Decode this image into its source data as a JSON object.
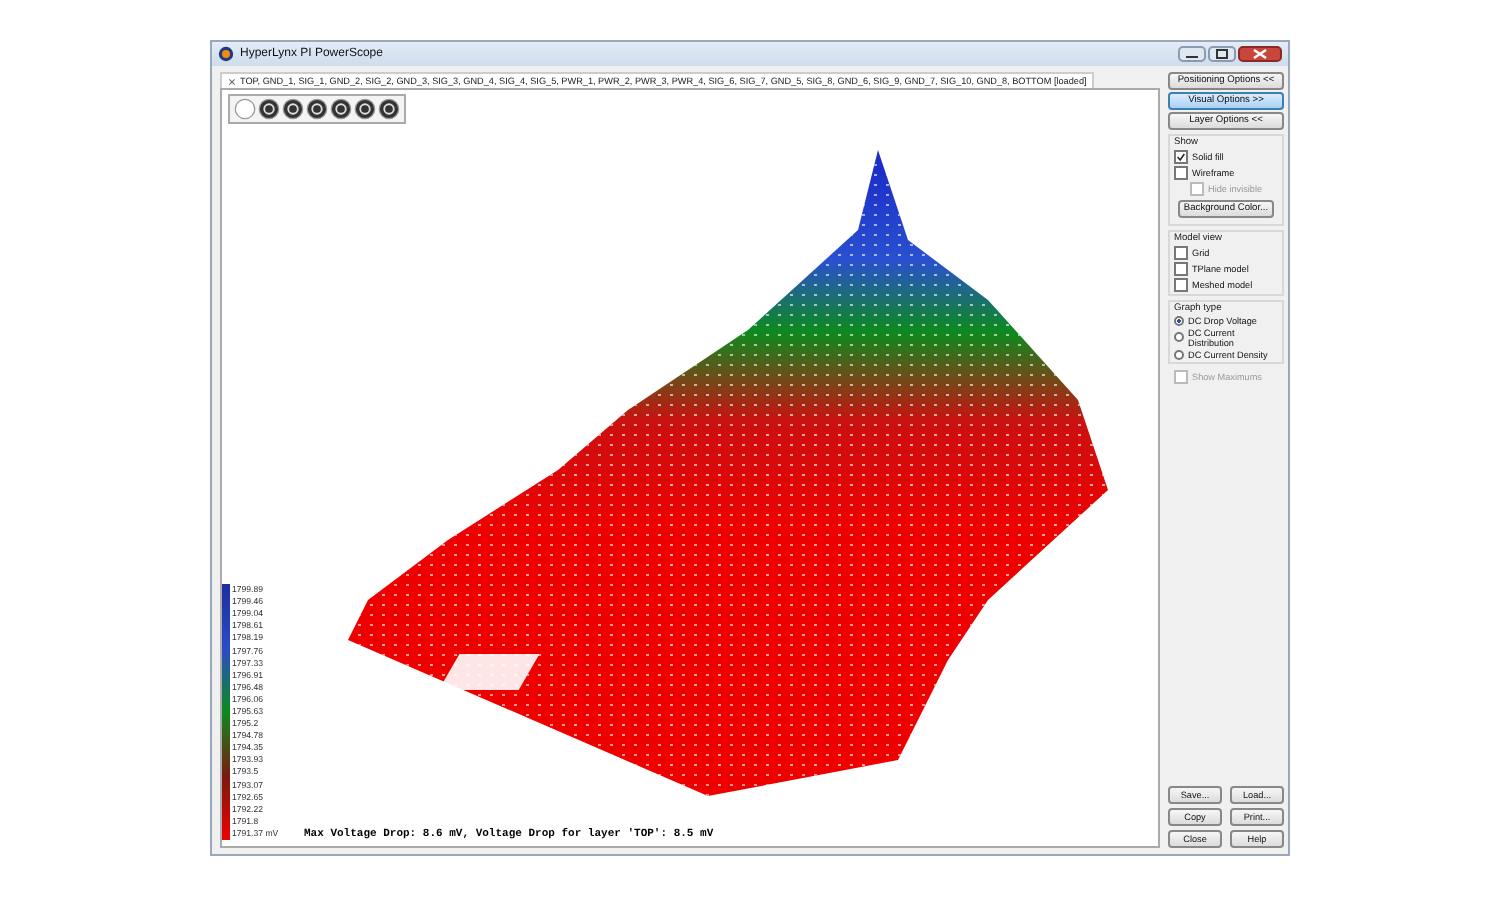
{
  "window": {
    "title": "HyperLynx PI PowerScope"
  },
  "tab": {
    "label": "TOP, GND_1, SIG_1, GND_2, SIG_2, GND_3, SIG_3, GND_4, SIG_4, SIG_5, PWR_1, PWR_2, PWR_3, PWR_4, SIG_6, SIG_7, GND_5, SIG_8, GND_6, SIG_9, GND_7, SIG_10, GND_8, BOTTOM [loaded]",
    "selected": true
  },
  "legend": {
    "labels": [
      "1799.89",
      "1799.46",
      "1799.04",
      "1798.61",
      "1798.19",
      "1797.76",
      "1797.33",
      "1796.91",
      "1796.48",
      "1796.06",
      "1795.63",
      "1795.2",
      "1794.78",
      "1794.35",
      "1793.93",
      "1793.5",
      "1793.07",
      "1792.65",
      "1792.22",
      "1791.8",
      "1791.37 mV"
    ]
  },
  "status": "Max Voltage Drop: 8.6 mV, Voltage Drop for layer 'TOP': 8.5 mV",
  "option_buttons": [
    {
      "label": "Positioning Options <<",
      "selected": false
    },
    {
      "label": "Visual Options >>",
      "selected": true
    },
    {
      "label": "Layer Options <<",
      "selected": false
    }
  ],
  "groups": [
    {
      "title": "Show",
      "items": [
        {
          "kind": "checkbox",
          "label": "Solid fill",
          "checked": true,
          "disabled": false
        },
        {
          "kind": "checkbox",
          "label": "Wireframe",
          "checked": false,
          "disabled": false
        },
        {
          "kind": "subcheckbox",
          "label": "Hide invisible",
          "checked": false,
          "disabled": true
        },
        {
          "kind": "button",
          "label": "Background Color..."
        }
      ]
    },
    {
      "title": "Model view",
      "items": [
        {
          "kind": "checkbox",
          "label": "Grid",
          "checked": false,
          "disabled": false
        },
        {
          "kind": "checkbox",
          "label": "TPlane model",
          "checked": false,
          "disabled": false
        },
        {
          "kind": "checkbox",
          "label": "Meshed model",
          "checked": false,
          "disabled": false
        }
      ]
    },
    {
      "title": "Graph type",
      "items": [
        {
          "kind": "radio",
          "label": "DC Drop Voltage",
          "selected": true
        },
        {
          "kind": "radio",
          "label": "DC Current Distribution",
          "selected": false
        },
        {
          "kind": "radio",
          "label": "DC Current Density",
          "selected": false
        }
      ]
    }
  ],
  "extra_items": [
    {
      "kind": "checkbox",
      "label": "Show Maximums",
      "checked": false,
      "disabled": true
    }
  ],
  "bottom_buttons": [
    "Save...",
    "Load...",
    "Copy",
    "Print...",
    "Close",
    "Help"
  ]
}
